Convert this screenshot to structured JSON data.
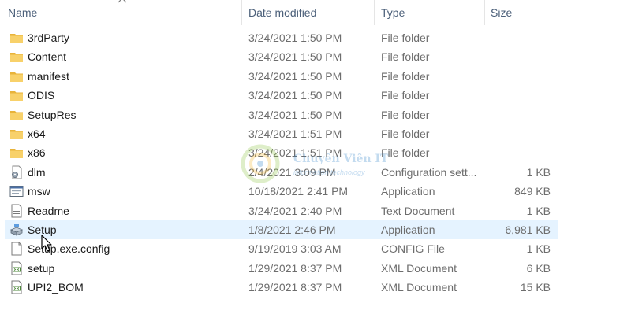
{
  "columns": {
    "name": "Name",
    "date_modified": "Date modified",
    "type": "Type",
    "size": "Size"
  },
  "files": [
    {
      "name": "3rdParty",
      "date": "3/24/2021 1:50 PM",
      "type": "File folder",
      "size": "",
      "icon": "folder-icon"
    },
    {
      "name": "Content",
      "date": "3/24/2021 1:50 PM",
      "type": "File folder",
      "size": "",
      "icon": "folder-icon"
    },
    {
      "name": "manifest",
      "date": "3/24/2021 1:50 PM",
      "type": "File folder",
      "size": "",
      "icon": "folder-icon"
    },
    {
      "name": "ODIS",
      "date": "3/24/2021 1:50 PM",
      "type": "File folder",
      "size": "",
      "icon": "folder-icon"
    },
    {
      "name": "SetupRes",
      "date": "3/24/2021 1:50 PM",
      "type": "File folder",
      "size": "",
      "icon": "folder-icon"
    },
    {
      "name": "x64",
      "date": "3/24/2021 1:51 PM",
      "type": "File folder",
      "size": "",
      "icon": "folder-icon"
    },
    {
      "name": "x86",
      "date": "3/24/2021 1:51 PM",
      "type": "File folder",
      "size": "",
      "icon": "folder-icon"
    },
    {
      "name": "dlm",
      "date": "2/4/2021 3:09 PM",
      "type": "Configuration sett...",
      "size": "1 KB",
      "icon": "config-file-icon"
    },
    {
      "name": "msw",
      "date": "10/18/2021 2:41 PM",
      "type": "Application",
      "size": "849 KB",
      "icon": "application-icon"
    },
    {
      "name": "Readme",
      "date": "3/24/2021 2:40 PM",
      "type": "Text Document",
      "size": "1 KB",
      "icon": "text-document-icon"
    },
    {
      "name": "Setup",
      "date": "1/8/2021 2:46 PM",
      "type": "Application",
      "size": "6,981 KB",
      "icon": "installer-icon",
      "selected": true
    },
    {
      "name": "Setup.exe.config",
      "date": "9/19/2019 3:03 AM",
      "type": "CONFIG File",
      "size": "1 KB",
      "icon": "blank-file-icon"
    },
    {
      "name": "setup",
      "date": "1/29/2021 8:37 PM",
      "type": "XML Document",
      "size": "6 KB",
      "icon": "xml-document-icon"
    },
    {
      "name": "UPI2_BOM",
      "date": "1/29/2021 8:37 PM",
      "type": "XML Document",
      "size": "15 KB",
      "icon": "xml-document-icon"
    }
  ],
  "watermark": {
    "title": "Chuyên Viên IT",
    "subtitle": "information technology"
  },
  "colors": {
    "folder": "#f3c44f",
    "selected_row": "#e5f3ff",
    "header_text": "#4c607a",
    "watermark": "#2a7fc9"
  }
}
